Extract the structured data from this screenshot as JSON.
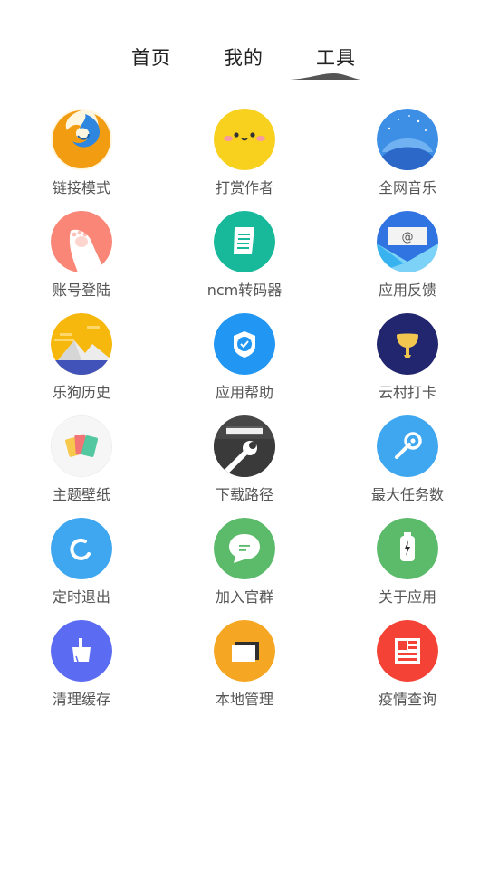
{
  "tabs": [
    {
      "label": "首页"
    },
    {
      "label": "我的"
    },
    {
      "label": "工具"
    }
  ],
  "active_tab": 2,
  "tools": [
    {
      "label": "链接模式",
      "icon": "firefox-icon",
      "color": "#F5A623"
    },
    {
      "label": "打赏作者",
      "icon": "smiley-face-icon",
      "color": "#F8D01E"
    },
    {
      "label": "全网音乐",
      "icon": "night-hill-icon",
      "color": "#3D8FE6"
    },
    {
      "label": "账号登陆",
      "icon": "paw-icon",
      "color": "#F98676"
    },
    {
      "label": "ncm转码器",
      "icon": "document-icon",
      "color": "#17B99A"
    },
    {
      "label": "应用反馈",
      "icon": "email-icon",
      "color": "#2F74E0"
    },
    {
      "label": "乐狗历史",
      "icon": "mountain-sunset-icon",
      "color": "#F7B80E"
    },
    {
      "label": "应用帮助",
      "icon": "shield-check-icon",
      "color": "#2196F3"
    },
    {
      "label": "云村打卡",
      "icon": "trophy-icon",
      "color": "#2A2F7A"
    },
    {
      "label": "主题壁纸",
      "icon": "color-cards-icon",
      "color": "#F4F4F4"
    },
    {
      "label": "下载路径",
      "icon": "wrench-folder-icon",
      "color": "#4A4A4A"
    },
    {
      "label": "最大任务数",
      "icon": "wrench-icon",
      "color": "#3FA7F0"
    },
    {
      "label": "定时退出",
      "icon": "refresh-icon",
      "color": "#3FA7F0"
    },
    {
      "label": "加入官群",
      "icon": "chat-bubble-icon",
      "color": "#5CBB6A"
    },
    {
      "label": "关于应用",
      "icon": "battery-bottle-icon",
      "color": "#5CBB6A"
    },
    {
      "label": "清理缓存",
      "icon": "broom-icon",
      "color": "#5B6BF2"
    },
    {
      "label": "本地管理",
      "icon": "folder-icon",
      "color": "#F5A623"
    },
    {
      "label": "疫情查询",
      "icon": "newspaper-icon",
      "color": "#F44336"
    }
  ]
}
